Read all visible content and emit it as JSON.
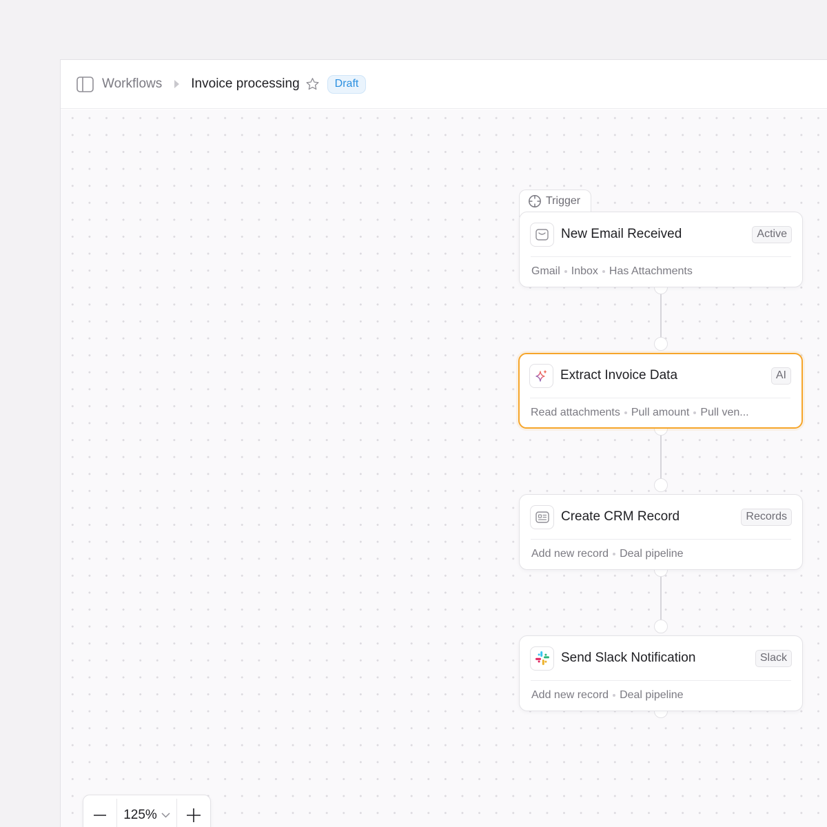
{
  "breadcrumb": {
    "root": "Workflows",
    "current": "Invoice processing",
    "status_badge": "Draft"
  },
  "trigger_label": "Trigger",
  "nodes": [
    {
      "title": "New Email Received",
      "tag": "Active",
      "meta": [
        "Gmail",
        "Inbox",
        "Has Attachments"
      ],
      "icon": "mail-icon"
    },
    {
      "title": "Extract Invoice Data",
      "tag": "AI",
      "meta": [
        "Read attachments",
        "Pull amount",
        "Pull ven..."
      ],
      "icon": "sparkle-icon",
      "selected": true
    },
    {
      "title": "Create CRM Record",
      "tag": "Records",
      "meta": [
        "Add new record",
        "Deal pipeline"
      ],
      "icon": "record-card-icon"
    },
    {
      "title": "Send Slack Notification",
      "tag": "Slack",
      "meta": [
        "Add new record",
        "Deal pipeline"
      ],
      "icon": "slack-icon"
    }
  ],
  "zoom": {
    "level": "125%"
  },
  "colors": {
    "selected_border": "#f6a52a",
    "draft_badge": "#2a8fe0"
  }
}
